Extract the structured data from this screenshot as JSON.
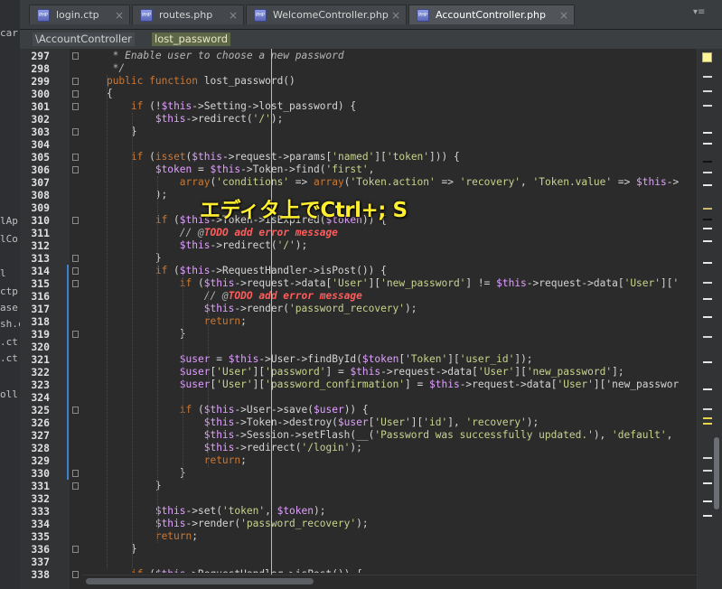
{
  "left_strip": [
    "car",
    "lAp",
    "lCo",
    "l",
    "ctp",
    "ase",
    "sh.c",
    ".ct",
    ".ct",
    "oll."
  ],
  "tabs": [
    {
      "label": "login.ctp",
      "active": false
    },
    {
      "label": "routes.php",
      "active": false
    },
    {
      "label": "WelcomeController.php",
      "active": false
    },
    {
      "label": "AccountController.php",
      "active": true
    }
  ],
  "tab_menu_label": "▾≡",
  "breadcrumb": {
    "class_name": "\\AccountController",
    "method_name": "lost_password"
  },
  "annotation_text": "エディタ上でCtrl+; S",
  "colors": {
    "keyword": "#cc7832",
    "variable": "#e0a0ff",
    "string": "#c7d48e",
    "todo": "#ff5c5c",
    "annotation": "#ffef2e"
  },
  "code_lines": [
    {
      "n": "297",
      "t": "     * Enable user to choose a new password"
    },
    {
      "n": "298",
      "t": "     */"
    },
    {
      "n": "299",
      "t": "    public function lost_password()"
    },
    {
      "n": "300",
      "t": "    {"
    },
    {
      "n": "301",
      "t": "        if (!$this->Setting->lost_password) {"
    },
    {
      "n": "302",
      "t": "            $this->redirect('/');"
    },
    {
      "n": "303",
      "t": "        }"
    },
    {
      "n": "304",
      "t": ""
    },
    {
      "n": "305",
      "t": "        if (isset($this->request->params['named']['token'])) {"
    },
    {
      "n": "306",
      "t": "            $token = $this->Token->find('first',"
    },
    {
      "n": "307",
      "t": "                array('conditions' => array('Token.action' => 'recovery', 'Token.value' => $this->"
    },
    {
      "n": "308",
      "t": "            );"
    },
    {
      "n": "309",
      "t": ""
    },
    {
      "n": "310",
      "t": "            if ($this->Token->isExpired($token)) {"
    },
    {
      "n": "311",
      "t": "                // @TODO add error message"
    },
    {
      "n": "312",
      "t": "                $this->redirect('/');"
    },
    {
      "n": "313",
      "t": "            }"
    },
    {
      "n": "314",
      "t": "            if ($this->RequestHandler->isPost()) {"
    },
    {
      "n": "315",
      "t": "                if ($this->request->data['User']['new_password'] != $this->request->data['User']['"
    },
    {
      "n": "316",
      "t": "                    // @TODO add error message"
    },
    {
      "n": "317",
      "t": "                    $this->render('password_recovery');"
    },
    {
      "n": "318",
      "t": "                    return;"
    },
    {
      "n": "319",
      "t": "                }"
    },
    {
      "n": "320",
      "t": ""
    },
    {
      "n": "321",
      "t": "                $user = $this->User->findById($token['Token']['user_id']);"
    },
    {
      "n": "322",
      "t": "                $user['User']['password'] = $this->request->data['User']['new_password'];"
    },
    {
      "n": "323",
      "t": "                $user['User']['password_confirmation'] = $this->request->data['User']['new_passwor"
    },
    {
      "n": "324",
      "t": ""
    },
    {
      "n": "325",
      "t": "                if ($this->User->save($user)) {"
    },
    {
      "n": "326",
      "t": "                    $this->Token->destroy($user['User']['id'], 'recovery');"
    },
    {
      "n": "327",
      "t": "                    $this->Session->setFlash(__('Password was successfully updated.'), 'default',"
    },
    {
      "n": "328",
      "t": "                    $this->redirect('/login');"
    },
    {
      "n": "329",
      "t": "                    return;"
    },
    {
      "n": "330",
      "t": "                }"
    },
    {
      "n": "331",
      "t": "            }"
    },
    {
      "n": "332",
      "t": ""
    },
    {
      "n": "333",
      "t": "            $this->set('token', $token);"
    },
    {
      "n": "334",
      "t": "            $this->render('password_recovery');"
    },
    {
      "n": "335",
      "t": "            return;"
    },
    {
      "n": "336",
      "t": "        }"
    },
    {
      "n": "337",
      "t": ""
    },
    {
      "n": "338",
      "t": "        if ($this->RequestHandler->isPost()) {"
    }
  ]
}
